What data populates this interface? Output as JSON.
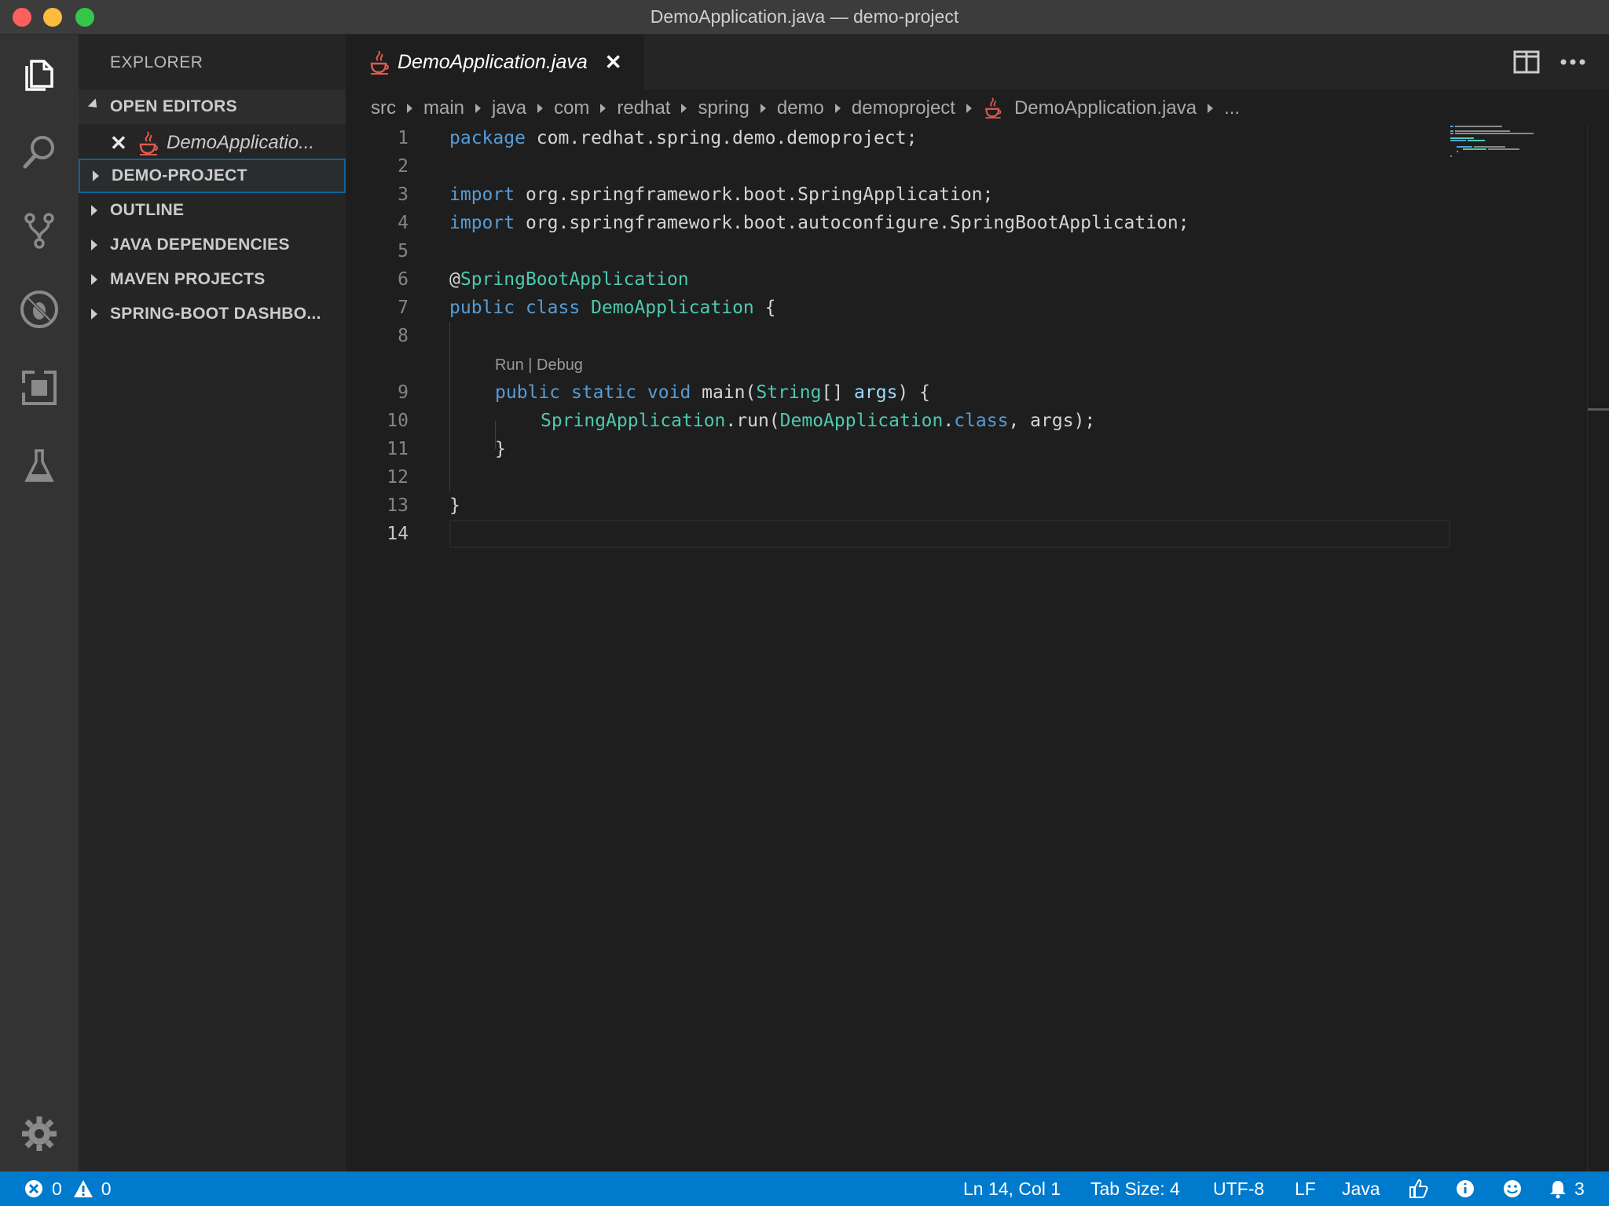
{
  "window": {
    "title": "DemoApplication.java — demo-project"
  },
  "activity_bar": {
    "icons": [
      "files-icon",
      "search-icon",
      "source-control-icon",
      "debug-icon",
      "extensions-icon",
      "test-icon",
      "gear-icon"
    ]
  },
  "sidebar": {
    "title": "EXPLORER",
    "sections": {
      "open_editors": "OPEN EDITORS",
      "demo_project": "DEMO-PROJECT",
      "outline": "OUTLINE",
      "java_dependencies": "JAVA DEPENDENCIES",
      "maven_projects": "MAVEN PROJECTS",
      "spring_boot_dashboard": "SPRING-BOOT DASHBO..."
    },
    "open_file": {
      "close": "✕",
      "name": "DemoApplicatio..."
    }
  },
  "editor": {
    "tab": {
      "label": "DemoApplication.java",
      "close": "✕"
    },
    "breadcrumbs": [
      "src",
      "main",
      "java",
      "com",
      "redhat",
      "spring",
      "demo",
      "demoproject",
      "DemoApplication.java",
      "..."
    ],
    "codelens": "Run | Debug",
    "line_numbers": [
      "1",
      "2",
      "3",
      "4",
      "5",
      "6",
      "7",
      "8",
      "9",
      "10",
      "11",
      "12",
      "13",
      "14"
    ],
    "code": {
      "l1_kw": "package",
      "l1_rest": " com.redhat.spring.demo.demoproject;",
      "l3_kw": "import",
      "l3_rest": " org.springframework.boot.SpringApplication;",
      "l4_kw": "import",
      "l4_rest": " org.springframework.boot.autoconfigure.SpringBootApplication;",
      "l6_at": "@",
      "l6_ann": "SpringBootApplication",
      "l7_kw1": "public",
      "l7_kw2": "class",
      "l7_type": "DemoApplication",
      "l7_rest": " {",
      "l9_kw1": "public",
      "l9_kw2": "static",
      "l9_kw3": "void",
      "l9_main": " main(",
      "l9_type": "String",
      "l9_br": "[] ",
      "l9_var": "args",
      "l9_rest": ") {",
      "l10_type1": "SpringApplication",
      "l10_run": ".run(",
      "l10_type2": "DemoApplication",
      "l10_dot": ".",
      "l10_kw": "class",
      "l10_rest": ", args);",
      "l11": "}",
      "l13": "}"
    }
  },
  "status_bar": {
    "errors": "0",
    "warnings": "0",
    "position": "Ln 14, Col 1",
    "tab_size": "Tab Size: 4",
    "encoding": "UTF-8",
    "eol": "LF",
    "language": "Java",
    "notifications": "3"
  },
  "colors": {
    "accent": "#007acc",
    "keyword": "#569cd6",
    "type": "#4ec9b0",
    "variable": "#9cdcfe"
  }
}
